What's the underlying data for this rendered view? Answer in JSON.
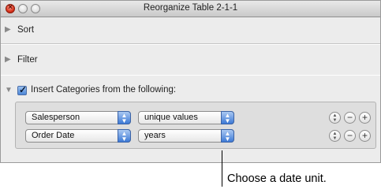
{
  "window": {
    "title": "Reorganize Table 2-1-1",
    "close_glyph": "×"
  },
  "sections": {
    "sort": {
      "label": "Sort",
      "icon": "disclosure-right-icon"
    },
    "filter": {
      "label": "Filter",
      "icon": "disclosure-right-icon"
    },
    "insert": {
      "label": "Insert Categories from the following:",
      "checked": true,
      "check_glyph": "✓",
      "rows": [
        {
          "column": "Salesperson",
          "grouping": "unique values"
        },
        {
          "column": "Order Date",
          "grouping": "years"
        }
      ]
    }
  },
  "glyphs": {
    "popup_arrows_up": "▲",
    "popup_arrows_down": "▼",
    "stepper_up": "▲",
    "stepper_down": "▼",
    "remove": "−",
    "add": "+",
    "disclosure_right": "▶",
    "disclosure_down": "▼"
  },
  "callout": {
    "text": "Choose a date unit."
  },
  "colors": {
    "accent": "#3d7ad6",
    "close": "#d9331c"
  }
}
